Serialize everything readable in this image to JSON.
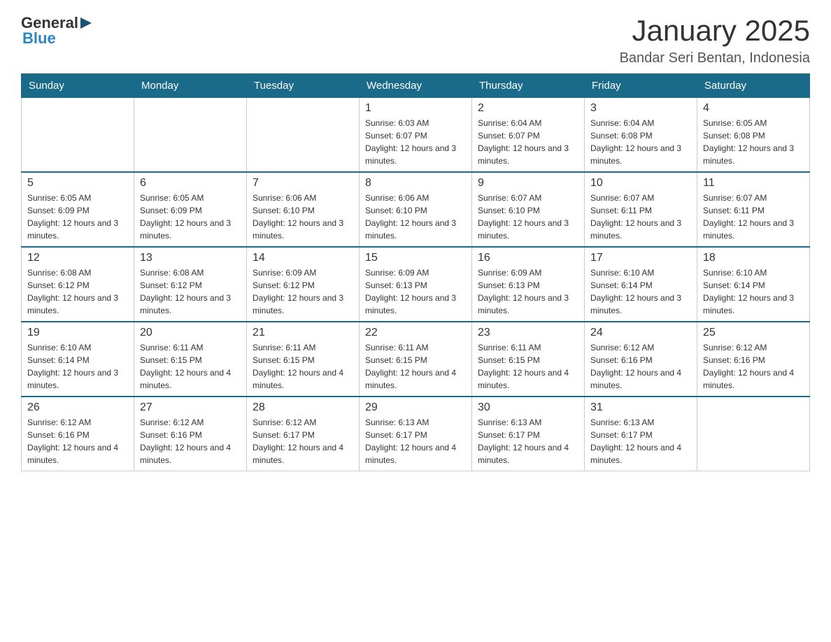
{
  "header": {
    "logo_general": "General",
    "logo_blue": "Blue",
    "title": "January 2025",
    "subtitle": "Bandar Seri Bentan, Indonesia"
  },
  "days_of_week": [
    "Sunday",
    "Monday",
    "Tuesday",
    "Wednesday",
    "Thursday",
    "Friday",
    "Saturday"
  ],
  "weeks": [
    [
      {
        "day": "",
        "info": ""
      },
      {
        "day": "",
        "info": ""
      },
      {
        "day": "",
        "info": ""
      },
      {
        "day": "1",
        "info": "Sunrise: 6:03 AM\nSunset: 6:07 PM\nDaylight: 12 hours and 3 minutes."
      },
      {
        "day": "2",
        "info": "Sunrise: 6:04 AM\nSunset: 6:07 PM\nDaylight: 12 hours and 3 minutes."
      },
      {
        "day": "3",
        "info": "Sunrise: 6:04 AM\nSunset: 6:08 PM\nDaylight: 12 hours and 3 minutes."
      },
      {
        "day": "4",
        "info": "Sunrise: 6:05 AM\nSunset: 6:08 PM\nDaylight: 12 hours and 3 minutes."
      }
    ],
    [
      {
        "day": "5",
        "info": "Sunrise: 6:05 AM\nSunset: 6:09 PM\nDaylight: 12 hours and 3 minutes."
      },
      {
        "day": "6",
        "info": "Sunrise: 6:05 AM\nSunset: 6:09 PM\nDaylight: 12 hours and 3 minutes."
      },
      {
        "day": "7",
        "info": "Sunrise: 6:06 AM\nSunset: 6:10 PM\nDaylight: 12 hours and 3 minutes."
      },
      {
        "day": "8",
        "info": "Sunrise: 6:06 AM\nSunset: 6:10 PM\nDaylight: 12 hours and 3 minutes."
      },
      {
        "day": "9",
        "info": "Sunrise: 6:07 AM\nSunset: 6:10 PM\nDaylight: 12 hours and 3 minutes."
      },
      {
        "day": "10",
        "info": "Sunrise: 6:07 AM\nSunset: 6:11 PM\nDaylight: 12 hours and 3 minutes."
      },
      {
        "day": "11",
        "info": "Sunrise: 6:07 AM\nSunset: 6:11 PM\nDaylight: 12 hours and 3 minutes."
      }
    ],
    [
      {
        "day": "12",
        "info": "Sunrise: 6:08 AM\nSunset: 6:12 PM\nDaylight: 12 hours and 3 minutes."
      },
      {
        "day": "13",
        "info": "Sunrise: 6:08 AM\nSunset: 6:12 PM\nDaylight: 12 hours and 3 minutes."
      },
      {
        "day": "14",
        "info": "Sunrise: 6:09 AM\nSunset: 6:12 PM\nDaylight: 12 hours and 3 minutes."
      },
      {
        "day": "15",
        "info": "Sunrise: 6:09 AM\nSunset: 6:13 PM\nDaylight: 12 hours and 3 minutes."
      },
      {
        "day": "16",
        "info": "Sunrise: 6:09 AM\nSunset: 6:13 PM\nDaylight: 12 hours and 3 minutes."
      },
      {
        "day": "17",
        "info": "Sunrise: 6:10 AM\nSunset: 6:14 PM\nDaylight: 12 hours and 3 minutes."
      },
      {
        "day": "18",
        "info": "Sunrise: 6:10 AM\nSunset: 6:14 PM\nDaylight: 12 hours and 3 minutes."
      }
    ],
    [
      {
        "day": "19",
        "info": "Sunrise: 6:10 AM\nSunset: 6:14 PM\nDaylight: 12 hours and 3 minutes."
      },
      {
        "day": "20",
        "info": "Sunrise: 6:11 AM\nSunset: 6:15 PM\nDaylight: 12 hours and 4 minutes."
      },
      {
        "day": "21",
        "info": "Sunrise: 6:11 AM\nSunset: 6:15 PM\nDaylight: 12 hours and 4 minutes."
      },
      {
        "day": "22",
        "info": "Sunrise: 6:11 AM\nSunset: 6:15 PM\nDaylight: 12 hours and 4 minutes."
      },
      {
        "day": "23",
        "info": "Sunrise: 6:11 AM\nSunset: 6:15 PM\nDaylight: 12 hours and 4 minutes."
      },
      {
        "day": "24",
        "info": "Sunrise: 6:12 AM\nSunset: 6:16 PM\nDaylight: 12 hours and 4 minutes."
      },
      {
        "day": "25",
        "info": "Sunrise: 6:12 AM\nSunset: 6:16 PM\nDaylight: 12 hours and 4 minutes."
      }
    ],
    [
      {
        "day": "26",
        "info": "Sunrise: 6:12 AM\nSunset: 6:16 PM\nDaylight: 12 hours and 4 minutes."
      },
      {
        "day": "27",
        "info": "Sunrise: 6:12 AM\nSunset: 6:16 PM\nDaylight: 12 hours and 4 minutes."
      },
      {
        "day": "28",
        "info": "Sunrise: 6:12 AM\nSunset: 6:17 PM\nDaylight: 12 hours and 4 minutes."
      },
      {
        "day": "29",
        "info": "Sunrise: 6:13 AM\nSunset: 6:17 PM\nDaylight: 12 hours and 4 minutes."
      },
      {
        "day": "30",
        "info": "Sunrise: 6:13 AM\nSunset: 6:17 PM\nDaylight: 12 hours and 4 minutes."
      },
      {
        "day": "31",
        "info": "Sunrise: 6:13 AM\nSunset: 6:17 PM\nDaylight: 12 hours and 4 minutes."
      },
      {
        "day": "",
        "info": ""
      }
    ]
  ]
}
